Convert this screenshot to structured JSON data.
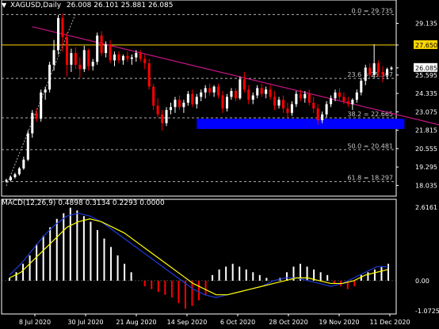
{
  "header": {
    "symbol": "XAGUSD,Daily",
    "ohlc": "26.008 26.101 25.881 26.085"
  },
  "macd_header": "MACD(12,26,9) 0.4898 0.3134 0.2293 0.0000",
  "colors": {
    "background": "#000000",
    "bull_candle": "#ffffff",
    "bear_candle": "#ff0000",
    "trendline": "#c71585",
    "support_zone": "#0000ff",
    "resistance_line": "#ffd700",
    "fib_level": "#b0b0b0",
    "macd_hist_positive": "#ffffff",
    "macd_hist_negative": "#ff0000",
    "macd_line": "#1e3ad6",
    "signal_line": "#ffff00"
  },
  "chart_data": {
    "type": "candlestick",
    "instrument": "XAGUSD",
    "timeframe": "Daily",
    "ylim": [
      17.3,
      30.3
    ],
    "price_ticks": [
      "29.135",
      "27.650",
      "26.085",
      "25.595",
      "24.335",
      "23.075",
      "21.815",
      "20.555",
      "19.295",
      "18.035"
    ],
    "x_ticks": [
      "8 Jul 2020",
      "30 Jul 2020",
      "21 Aug 2020",
      "14 Sep 2020",
      "6 Oct 2020",
      "28 Oct 2020",
      "19 Nov 2020",
      "11 Dec 2020"
    ],
    "current_price": "26.085",
    "resistance": "27.650",
    "fib_levels": [
      {
        "label": "0.0 = 29.735",
        "value": 29.735
      },
      {
        "label": "23.6 = 25.367",
        "value": 25.367
      },
      {
        "label": "38.2 = 22.665",
        "value": 22.665
      },
      {
        "label": "50.0 = 20.481",
        "value": 20.481
      },
      {
        "label": "61.8 = 18.297",
        "value": 18.297
      }
    ],
    "support_zone": [
      21.9,
      22.6
    ],
    "trendline": {
      "from": [
        6,
        28.9
      ],
      "to": [
        104,
        21.9
      ]
    },
    "fib_anchor": {
      "from": [
        0,
        18.0
      ],
      "to": [
        16,
        29.8
      ]
    },
    "candles": [
      [
        18.3,
        18.5,
        18.2,
        18.4
      ],
      [
        18.4,
        18.7,
        18.3,
        18.6
      ],
      [
        18.6,
        18.9,
        18.5,
        18.8
      ],
      [
        18.8,
        19.3,
        18.7,
        19.2
      ],
      [
        19.2,
        20.0,
        19.1,
        19.8
      ],
      [
        19.8,
        21.8,
        19.7,
        21.6
      ],
      [
        21.6,
        23.2,
        21.3,
        23.0
      ],
      [
        23.0,
        23.3,
        22.4,
        22.6
      ],
      [
        22.6,
        24.6,
        22.4,
        24.4
      ],
      [
        24.4,
        24.8,
        23.9,
        24.6
      ],
      [
        24.6,
        26.5,
        24.4,
        26.3
      ],
      [
        26.3,
        28.0,
        25.9,
        27.3
      ],
      [
        27.3,
        29.7,
        27.0,
        29.5
      ],
      [
        29.5,
        29.8,
        27.2,
        28.2
      ],
      [
        28.2,
        28.5,
        25.5,
        26.3
      ],
      [
        26.3,
        27.4,
        25.8,
        27.1
      ],
      [
        27.1,
        27.5,
        26.0,
        26.3
      ],
      [
        26.3,
        26.8,
        25.4,
        26.0
      ],
      [
        26.0,
        27.6,
        25.8,
        27.3
      ],
      [
        27.3,
        27.4,
        25.9,
        26.2
      ],
      [
        26.2,
        26.7,
        25.9,
        26.5
      ],
      [
        26.5,
        28.5,
        26.3,
        28.3
      ],
      [
        28.3,
        28.6,
        26.9,
        27.1
      ],
      [
        27.1,
        27.9,
        26.8,
        27.7
      ],
      [
        27.7,
        28.0,
        26.4,
        26.6
      ],
      [
        26.6,
        27.2,
        26.2,
        27.0
      ],
      [
        27.0,
        27.2,
        26.4,
        26.6
      ],
      [
        26.6,
        27.0,
        26.3,
        26.9
      ],
      [
        26.9,
        27.2,
        26.5,
        26.7
      ],
      [
        26.7,
        27.0,
        26.3,
        26.8
      ],
      [
        26.8,
        27.3,
        26.5,
        27.1
      ],
      [
        27.1,
        27.3,
        26.5,
        26.7
      ],
      [
        26.7,
        27.0,
        26.0,
        26.4
      ],
      [
        26.4,
        26.7,
        24.6,
        24.8
      ],
      [
        24.8,
        25.0,
        23.2,
        23.5
      ],
      [
        23.5,
        24.0,
        22.7,
        22.9
      ],
      [
        22.9,
        23.2,
        21.8,
        22.3
      ],
      [
        22.3,
        23.4,
        22.1,
        23.2
      ],
      [
        23.2,
        23.7,
        22.9,
        23.4
      ],
      [
        23.4,
        24.1,
        23.0,
        23.9
      ],
      [
        23.9,
        24.2,
        23.2,
        23.4
      ],
      [
        23.4,
        23.9,
        23.0,
        23.7
      ],
      [
        23.7,
        24.5,
        23.5,
        24.3
      ],
      [
        24.3,
        24.6,
        23.4,
        23.6
      ],
      [
        23.6,
        24.3,
        23.3,
        24.1
      ],
      [
        24.1,
        24.6,
        23.8,
        24.4
      ],
      [
        24.4,
        24.9,
        24.0,
        24.7
      ],
      [
        24.7,
        25.0,
        24.2,
        24.4
      ],
      [
        24.4,
        24.9,
        24.1,
        24.8
      ],
      [
        24.8,
        25.0,
        24.0,
        24.2
      ],
      [
        24.2,
        24.5,
        23.0,
        23.3
      ],
      [
        23.3,
        24.3,
        23.1,
        24.1
      ],
      [
        24.1,
        24.7,
        23.9,
        24.5
      ],
      [
        24.5,
        24.7,
        23.8,
        24.0
      ],
      [
        24.0,
        25.5,
        23.9,
        25.3
      ],
      [
        25.3,
        25.8,
        24.4,
        24.6
      ],
      [
        24.6,
        24.9,
        23.6,
        23.9
      ],
      [
        23.9,
        24.4,
        23.6,
        24.2
      ],
      [
        24.2,
        24.9,
        24.0,
        24.7
      ],
      [
        24.7,
        25.0,
        24.1,
        24.3
      ],
      [
        24.3,
        24.8,
        24.0,
        24.6
      ],
      [
        24.6,
        24.9,
        23.9,
        24.1
      ],
      [
        24.1,
        24.5,
        23.2,
        23.5
      ],
      [
        23.5,
        24.1,
        23.3,
        23.9
      ],
      [
        23.9,
        24.2,
        23.0,
        23.3
      ],
      [
        23.3,
        23.7,
        22.6,
        23.0
      ],
      [
        23.0,
        23.8,
        22.8,
        23.6
      ],
      [
        23.6,
        24.5,
        23.4,
        24.3
      ],
      [
        24.3,
        24.6,
        23.8,
        24.0
      ],
      [
        24.0,
        24.5,
        23.7,
        24.3
      ],
      [
        24.3,
        24.6,
        23.5,
        23.7
      ],
      [
        23.7,
        24.1,
        23.0,
        23.3
      ],
      [
        23.3,
        23.6,
        22.2,
        22.5
      ],
      [
        22.5,
        23.1,
        22.3,
        22.9
      ],
      [
        22.9,
        23.8,
        22.7,
        23.6
      ],
      [
        23.6,
        24.2,
        23.4,
        24.0
      ],
      [
        24.0,
        24.6,
        23.8,
        24.4
      ],
      [
        24.4,
        24.7,
        23.9,
        24.1
      ],
      [
        24.1,
        24.4,
        23.6,
        23.8
      ],
      [
        23.8,
        24.1,
        23.4,
        23.6
      ],
      [
        23.6,
        24.0,
        23.2,
        23.9
      ],
      [
        23.9,
        24.6,
        23.7,
        24.4
      ],
      [
        24.4,
        25.4,
        24.2,
        25.2
      ],
      [
        25.2,
        26.3,
        24.9,
        26.1
      ],
      [
        26.1,
        26.4,
        25.4,
        25.6
      ],
      [
        25.6,
        27.7,
        25.4,
        26.4
      ],
      [
        26.4,
        26.6,
        25.5,
        25.8
      ],
      [
        25.8,
        26.2,
        25.1,
        25.6
      ],
      [
        25.6,
        26.1,
        25.3,
        26.0
      ],
      [
        26.0,
        26.2,
        25.9,
        26.1
      ]
    ],
    "macd": {
      "ylim": [
        -1.0725,
        2.6161
      ],
      "ticks": [
        "2.6161",
        "0.00",
        "-1.0725"
      ],
      "histogram": [
        0.1,
        0.3,
        0.6,
        0.9,
        1.3,
        1.6,
        1.9,
        2.2,
        2.4,
        2.6,
        2.5,
        2.3,
        2.1,
        1.8,
        1.5,
        1.2,
        0.9,
        0.6,
        0.3,
        0.0,
        -0.2,
        -0.3,
        -0.4,
        -0.5,
        -0.6,
        -0.8,
        -1.0,
        -0.9,
        -0.7,
        -0.5,
        0.2,
        0.4,
        0.5,
        0.6,
        0.5,
        0.4,
        0.3,
        0.2,
        0.1,
        0.0,
        0.1,
        0.3,
        0.5,
        0.6,
        0.5,
        0.4,
        0.3,
        0.2,
        -0.1,
        -0.2,
        -0.3,
        -0.2,
        0.2,
        0.3,
        0.4,
        0.5,
        0.6
      ],
      "macd_line": [
        0.2,
        0.6,
        1.1,
        1.6,
        2.0,
        2.3,
        2.4,
        2.3,
        2.1,
        1.8,
        1.5,
        1.2,
        0.9,
        0.6,
        0.3,
        0.0,
        -0.3,
        -0.5,
        -0.6,
        -0.5,
        -0.4,
        -0.3,
        -0.2,
        0.0,
        0.1,
        0.1,
        0.0,
        -0.1,
        -0.2,
        -0.1,
        0.1,
        0.3,
        0.5,
        0.5
      ],
      "signal_line": [
        0.1,
        0.3,
        0.7,
        1.1,
        1.5,
        1.9,
        2.1,
        2.2,
        2.1,
        1.9,
        1.7,
        1.4,
        1.1,
        0.8,
        0.5,
        0.2,
        -0.1,
        -0.3,
        -0.5,
        -0.5,
        -0.4,
        -0.3,
        -0.2,
        -0.1,
        0.0,
        0.1,
        0.1,
        0.0,
        -0.1,
        -0.1,
        0.0,
        0.2,
        0.3,
        0.4
      ]
    }
  }
}
